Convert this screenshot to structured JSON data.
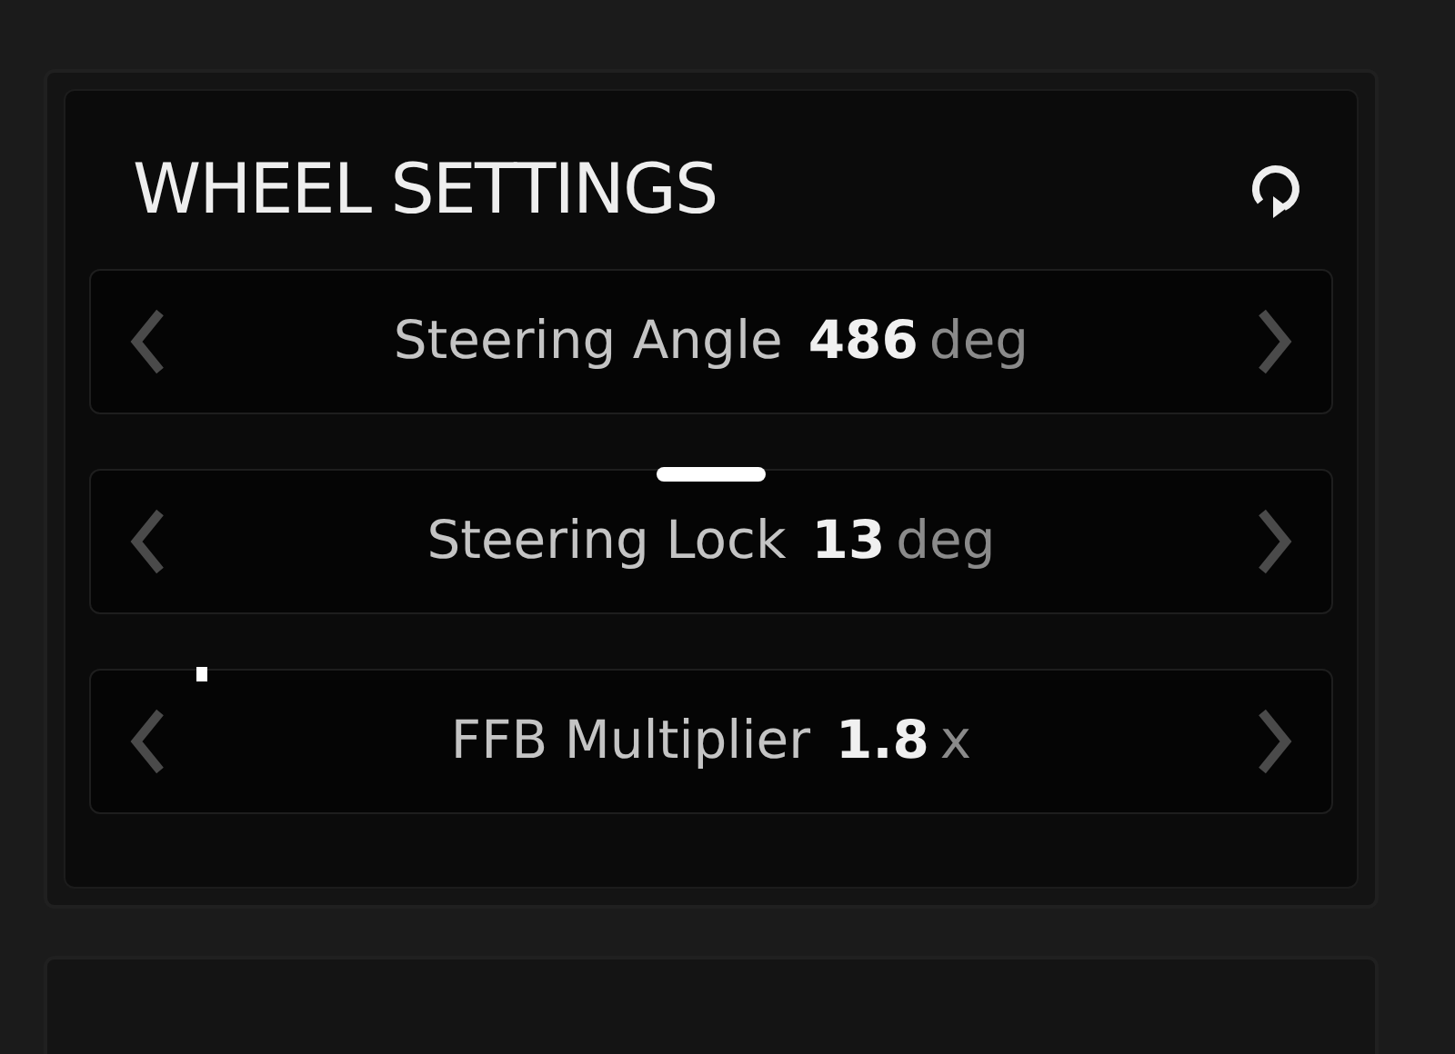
{
  "panel": {
    "title": "WHEEL SETTINGS"
  },
  "settings": [
    {
      "label": "Steering Angle",
      "value": "486",
      "unit": "deg"
    },
    {
      "label": "Steering Lock",
      "value": "13",
      "unit": "deg",
      "marker": {
        "kind": "bar",
        "level": 0.5
      }
    },
    {
      "label": "FFB Multiplier",
      "value": "1.8",
      "unit": "x",
      "marker": {
        "kind": "dot",
        "level": 0.09
      }
    }
  ]
}
